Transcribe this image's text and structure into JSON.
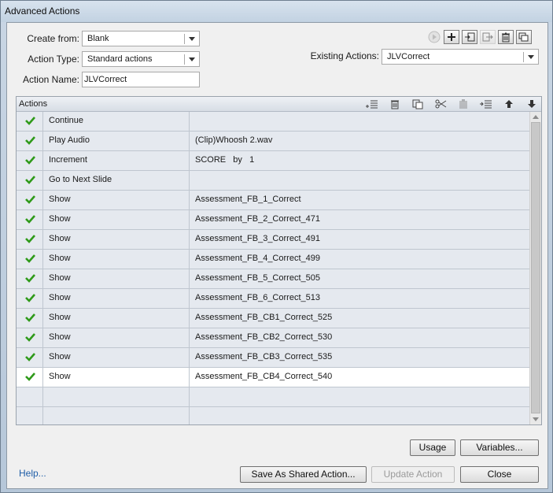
{
  "window": {
    "title": "Advanced Actions"
  },
  "form": {
    "create_from_label": "Create from:",
    "create_from_value": "Blank",
    "action_type_label": "Action Type:",
    "action_type_value": "Standard actions",
    "action_name_label": "Action Name:",
    "action_name_value": "JLVCorrect",
    "existing_actions_label": "Existing Actions:",
    "existing_actions_value": "JLVCorrect"
  },
  "toolbar_icons": [
    "play-icon",
    "add-icon",
    "import-icon",
    "export-icon",
    "delete-icon",
    "duplicate-icon"
  ],
  "actions_panel": {
    "title": "Actions",
    "toolbar_icons": [
      "insert-row-icon",
      "delete-row-icon",
      "copy-icon",
      "cut-icon",
      "paste-icon",
      "insert-above-icon",
      "move-up-icon",
      "move-down-icon"
    ],
    "rows": [
      {
        "checked": true,
        "action": "Continue",
        "target": ""
      },
      {
        "checked": true,
        "action": "Play Audio",
        "target": "(Clip)Whoosh 2.wav"
      },
      {
        "checked": true,
        "action": "Increment",
        "target": "SCORE   by   1"
      },
      {
        "checked": true,
        "action": "Go to Next Slide",
        "target": ""
      },
      {
        "checked": true,
        "action": "Show",
        "target": "Assessment_FB_1_Correct"
      },
      {
        "checked": true,
        "action": "Show",
        "target": "Assessment_FB_2_Correct_471"
      },
      {
        "checked": true,
        "action": "Show",
        "target": "Assessment_FB_3_Correct_491"
      },
      {
        "checked": true,
        "action": "Show",
        "target": "Assessment_FB_4_Correct_499"
      },
      {
        "checked": true,
        "action": "Show",
        "target": "Assessment_FB_5_Correct_505"
      },
      {
        "checked": true,
        "action": "Show",
        "target": "Assessment_FB_6_Correct_513"
      },
      {
        "checked": true,
        "action": "Show",
        "target": "Assessment_FB_CB1_Correct_525"
      },
      {
        "checked": true,
        "action": "Show",
        "target": "Assessment_FB_CB2_Correct_530"
      },
      {
        "checked": true,
        "action": "Show",
        "target": "Assessment_FB_CB3_Correct_535"
      },
      {
        "checked": true,
        "action": "Show",
        "target": "Assessment_FB_CB4_Correct_540",
        "selected": true
      },
      {
        "checked": false,
        "action": "",
        "target": ""
      },
      {
        "checked": false,
        "action": "",
        "target": ""
      }
    ]
  },
  "buttons": {
    "usage": "Usage",
    "variables": "Variables...",
    "help": "Help...",
    "save_shared": "Save As Shared Action...",
    "update": "Update Action",
    "close": "Close"
  },
  "colors": {
    "check": "#2f9a1a",
    "selected_row": "#ffffff",
    "row": "#e5e9ef"
  }
}
